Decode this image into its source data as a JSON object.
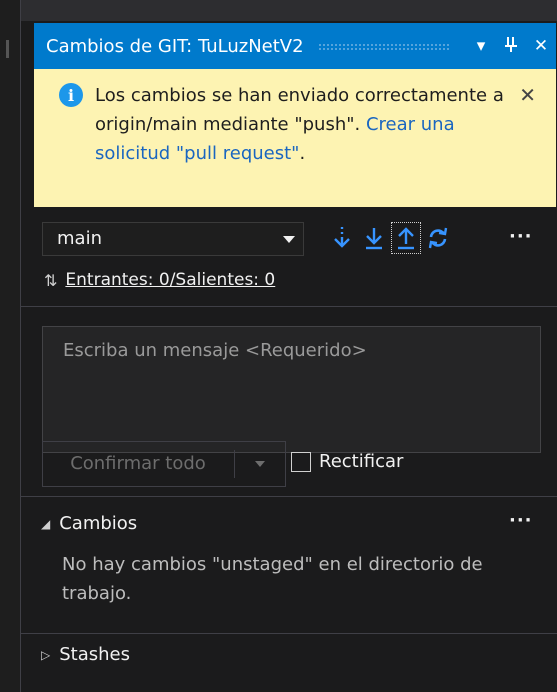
{
  "window": {
    "title": "Cambios de GIT: TuLuzNetV2",
    "controls": [
      {
        "name": "dropdown-icon",
        "glyph": "▾"
      },
      {
        "name": "pin-icon",
        "glyph": "ᵼ"
      },
      {
        "name": "close-icon",
        "glyph": "✕"
      }
    ]
  },
  "info_bar": {
    "icon": "info-icon",
    "icon_glyph": "i",
    "message": "Los cambios se han enviado correctamente a origin/main mediante \"push\". ",
    "link": "Crear una solicitud \"pull request\"",
    "message_end": ".",
    "close_glyph": "✕"
  },
  "toolbar": {
    "branch": "main",
    "actions": [
      "fetch-icon",
      "pull-icon",
      "push-icon",
      "sync-icon",
      "more-icon"
    ],
    "more_glyph": "···"
  },
  "sync": {
    "icon_glyph": "⇅",
    "label": "Entrantes: 0/Salientes: 0"
  },
  "commit": {
    "message_placeholder": "Escriba un mensaje <Requerido>",
    "commit_all_label": "Confirmar todo",
    "amend_label": "Rectificar",
    "amend_checked": false
  },
  "changes": {
    "expanded_glyph": "◢",
    "title": "Cambios",
    "more_glyph": "···",
    "empty_message": "No hay cambios \"unstaged\" en el directorio de trabajo."
  },
  "stashes": {
    "collapsed_glyph": "▷",
    "title": "Stashes"
  },
  "colors": {
    "accent": "#007acc",
    "info_bg": "#fdf3b2",
    "panel_bg": "#1b1b1c",
    "link": "#1a66c0",
    "icon_blue": "#3794ff"
  }
}
